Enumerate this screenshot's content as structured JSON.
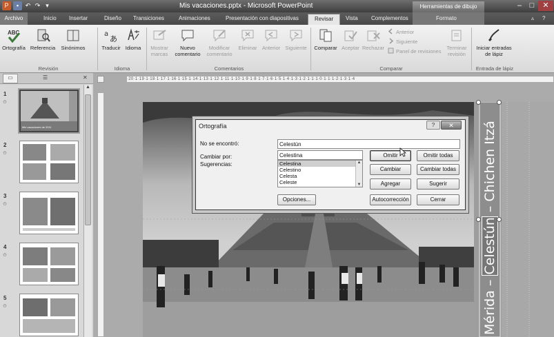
{
  "window": {
    "title": "Mis vacaciones.pptx - Microsoft PowerPoint",
    "context_title": "Herramientas de dibujo"
  },
  "tabs": {
    "file": "Archivo",
    "items": [
      "Inicio",
      "Insertar",
      "Diseño",
      "Transiciones",
      "Animaciones",
      "Presentación con diapositivas",
      "Revisar",
      "Vista",
      "Complementos",
      "Formato"
    ],
    "active": "Revisar"
  },
  "ribbon": {
    "groups": {
      "revision": "Revisión",
      "idioma": "Idioma",
      "comentarios": "Comentarios",
      "comparar": "Comparar",
      "entrada": "Entrada de lápiz"
    },
    "buttons": {
      "ortografia": "Ortografía",
      "referencia": "Referencia",
      "sinonimos": "Sinónimos",
      "traducir": "Traducir",
      "idioma": "Idioma",
      "mostrar_1": "Mostrar",
      "mostrar_2": "marcas",
      "nuevo_1": "Nuevo",
      "nuevo_2": "comentario",
      "modificar_1": "Modificar",
      "modificar_2": "comentario",
      "eliminar": "Eliminar",
      "anterior": "Anterior",
      "siguiente": "Siguiente",
      "comparar": "Comparar",
      "aceptar": "Aceptar",
      "rechazar": "Rechazar",
      "anterior_small": "Anterior",
      "siguiente_small": "Siguiente",
      "panel": "Panel de revisiones",
      "terminar_1": "Terminar",
      "terminar_2": "revisión",
      "iniciar_1": "Iniciar entradas",
      "iniciar_2": "de lápiz"
    }
  },
  "ruler": {
    "text": "·20·1·19·1·18·1·17·1·16·1·15·1·14·1·13·1·12·1·11·1·10·1·9·1·8·1·7·1·6·1·5·1·4·1·3·1·2·1·1·1·0·1·1·1·2·1·3·1·4"
  },
  "slides_panel": {
    "slides": [
      {
        "num": "1",
        "caption": "Mis vacaciones de 2011"
      },
      {
        "num": "2"
      },
      {
        "num": "3"
      },
      {
        "num": "4"
      },
      {
        "num": "5"
      }
    ]
  },
  "slide": {
    "vertical_text_1": "Mérida – ",
    "vertical_text_highlight": "Celestún",
    "vertical_text_2": " – Chichen Itzá"
  },
  "dialog": {
    "title": "Ortografía",
    "not_found_label": "No se encontró:",
    "not_found_value": "Celestún",
    "change_to_label": "Cambiar por:",
    "change_to_value": "Celestina",
    "suggestions_label": "Sugerencias:",
    "suggestions": [
      "Celestina",
      "Celestino",
      "Celesta",
      "Celeste"
    ],
    "selected_suggestion": "Celestina",
    "buttons": {
      "omitir": "Omitir",
      "omitir_todas": "Omitir todas",
      "cambiar": "Cambiar",
      "cambiar_todas": "Cambiar todas",
      "agregar": "Agregar",
      "sugerir": "Sugerir",
      "opciones": "Opciones...",
      "autocorreccion": "Autocorrección",
      "cerrar": "Cerrar"
    },
    "help_label": "?",
    "close_label": "✕"
  }
}
